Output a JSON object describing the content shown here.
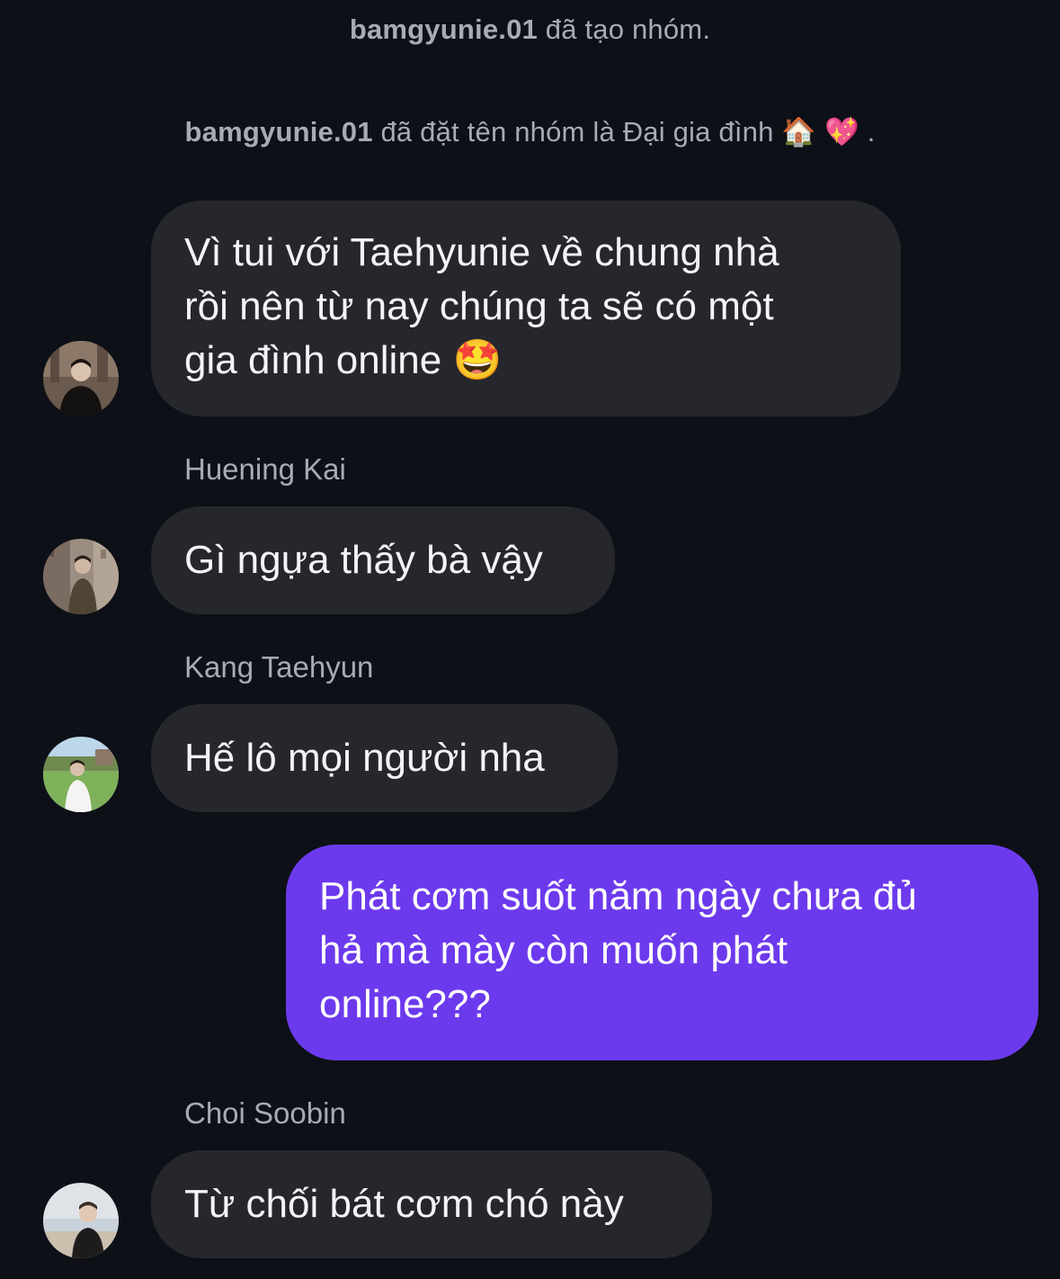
{
  "system_messages": [
    {
      "user": "bamgyunie.01",
      "text": " đã tạo nhóm."
    },
    {
      "user": "bamgyunie.01",
      "text": " đã đặt tên nhóm là Đại gia đình ",
      "emoji_house": "🏠",
      "emoji_heart": "💖",
      "suffix": " ."
    }
  ],
  "messages": [
    {
      "lines": [
        "Vì tui với Taehyunie về chung nhà",
        "rồi nên từ nay chúng ta sẽ có một",
        "gia đình online "
      ],
      "emoji": "🤩",
      "avatar": "avatar-bamgyunie"
    },
    {
      "sender": "Huening Kai",
      "lines": [
        "Gì ngựa thấy bà vậy"
      ],
      "avatar": "avatar-huening-kai"
    },
    {
      "sender": "Kang Taehyun",
      "lines": [
        "Hế lô mọi người nha"
      ],
      "avatar": "avatar-kang-taehyun"
    },
    {
      "own": true,
      "lines": [
        "Phát cơm suốt năm ngày chưa đủ",
        "hả mà mày còn muốn phát",
        "online???"
      ]
    },
    {
      "sender": "Choi Soobin",
      "lines": [
        "Từ chối bát cơm chó này"
      ],
      "avatar": "avatar-choi-soobin"
    }
  ],
  "colors": {
    "background": "#0d1016",
    "incoming_bubble": "#25272d",
    "outgoing_bubble": "#6c3aed",
    "secondary_text": "#a8abb2"
  }
}
